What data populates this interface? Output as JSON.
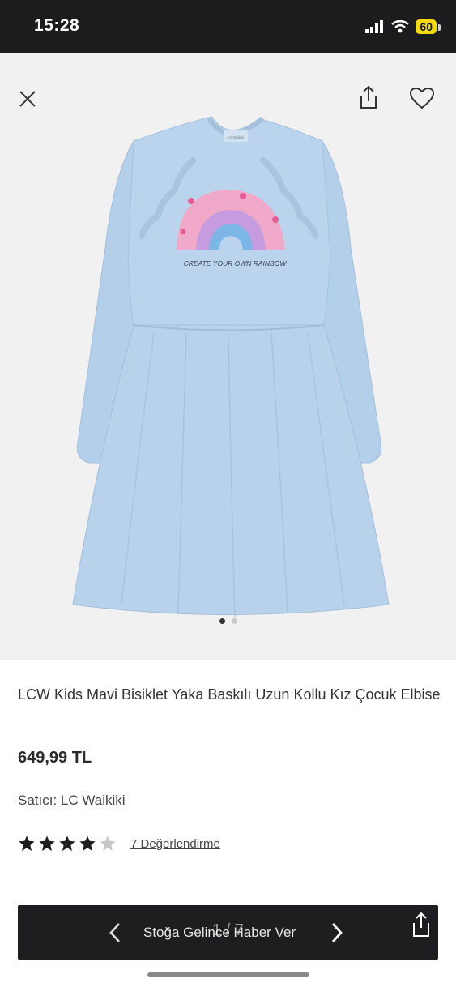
{
  "status_bar": {
    "time": "15:28",
    "battery": "60"
  },
  "gallery": {
    "print_text": "CREATE YOUR OWN RAINBOW",
    "label_text": "LC Waikiki",
    "current_image": 1,
    "total_images": 2
  },
  "product": {
    "title": "LCW Kids Mavi Bisiklet Yaka Baskılı Uzun Kollu Kız Çocuk Elbise",
    "price": "649,99 TL",
    "seller": "Satıcı: LC Waikiki",
    "rating": 4,
    "max_rating": 5,
    "reviews": "7 Değerlendirme"
  },
  "bottom_bar": {
    "label": "Stoğa Gelince Haber Ver",
    "counter": "1 / 7"
  },
  "colors": {
    "dress": "#b9d3ec",
    "status_bg": "#1c1c1e",
    "bar_bg": "#1e1e20",
    "battery": "#f5d90a"
  },
  "icons": [
    "signal-icon",
    "wifi-icon",
    "close-icon",
    "share-icon",
    "heart-icon",
    "star-icon",
    "chevron-left-icon",
    "chevron-right-icon"
  ]
}
